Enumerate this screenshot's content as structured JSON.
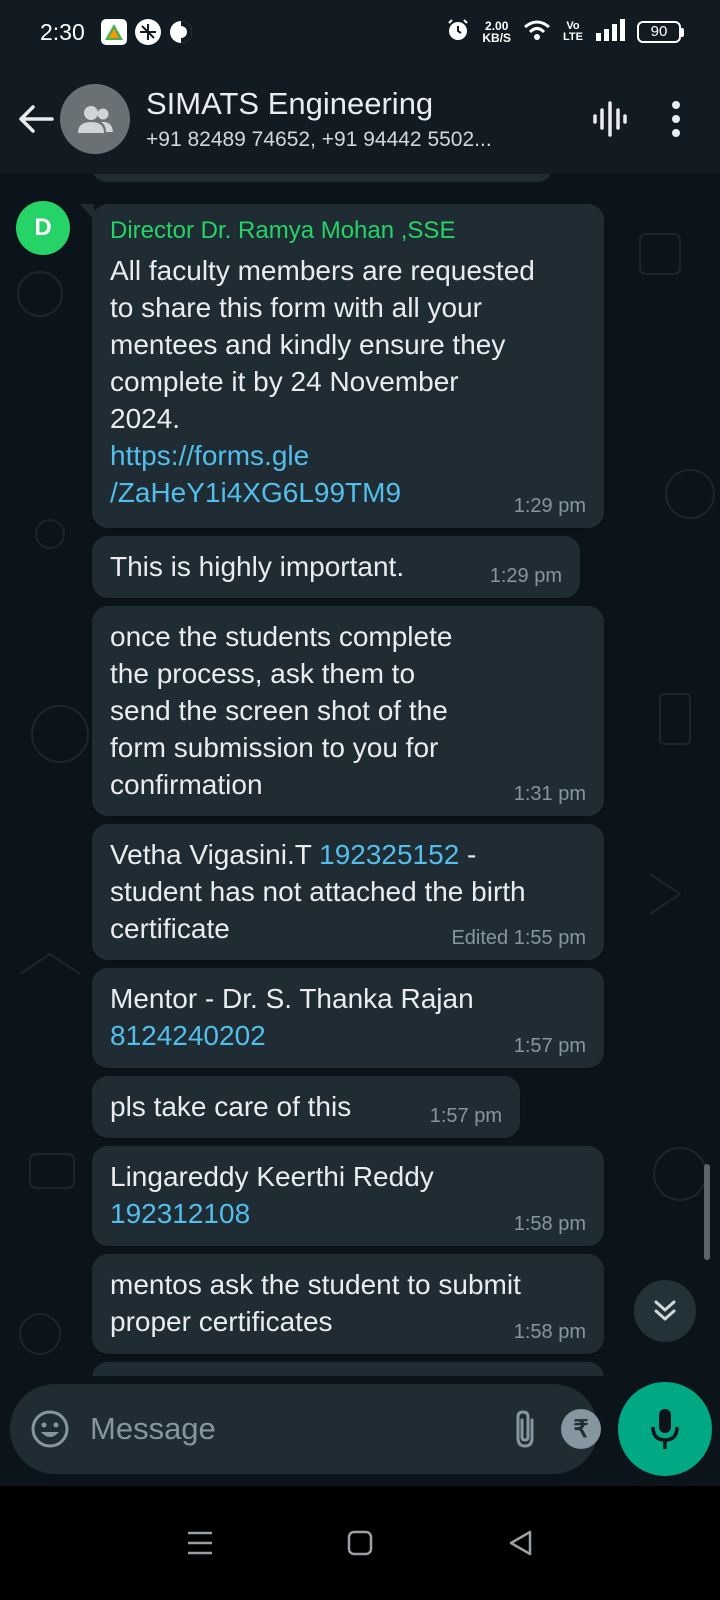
{
  "status_bar": {
    "time": "2:30",
    "net_speed_value": "2.00",
    "net_speed_unit": "KB/S",
    "network_tag_top": "Vo",
    "network_tag_bottom": "LTE",
    "battery": "90"
  },
  "header": {
    "title": "SIMATS Engineering",
    "subtitle": "+91 82489 74652, +91 94442 5502..."
  },
  "messages": [
    {
      "avatar_letter": "D",
      "sender": "Director Dr. Ramya Mohan ,SSE",
      "text": "All faculty members are requested\nto share this form with all your\nmentees and kindly ensure they\ncomplete it by 24 November\n2024.",
      "link": "https://forms.gle\n/ZaHeY1i4XG6L99TM9",
      "time": "1:29 pm"
    },
    {
      "text": "This is highly important.",
      "time": "1:29 pm"
    },
    {
      "text": "once the students complete\nthe process, ask them to\nsend the screen shot of the\nform submission to you for\nconfirmation",
      "time": "1:31 pm"
    },
    {
      "text_before": "Vetha Vigasini.T ",
      "link": "192325152",
      "text_after": " -\nstudent has not attached the birth\ncertificate",
      "time": "Edited 1:55 pm"
    },
    {
      "text": "Mentor - Dr. S. Thanka Rajan",
      "link": "8124240202",
      "time": "1:57 pm"
    },
    {
      "text": "pls take care of this",
      "time": "1:57 pm"
    },
    {
      "text": "Lingareddy Keerthi Reddy",
      "link": "192312108",
      "time": "1:58 pm"
    },
    {
      "text": "mentos ask the student to submit\nproper certificates",
      "time": "1:58 pm"
    }
  ],
  "composer": {
    "placeholder": "Message",
    "rupee_symbol": "₹"
  },
  "colors": {
    "accent_green": "#25d366",
    "link_blue": "#53bdeb",
    "bubble_bg": "#202c33",
    "mic_green": "#00a884"
  }
}
